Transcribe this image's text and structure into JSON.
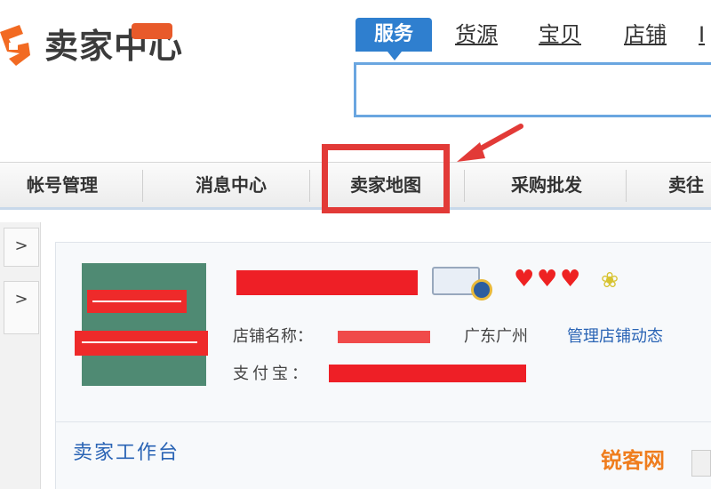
{
  "header": {
    "logo_text": "卖家中心",
    "search_tabs": [
      {
        "label": "服务",
        "active": true
      },
      {
        "label": "货源",
        "active": false
      },
      {
        "label": "宝贝",
        "active": false
      },
      {
        "label": "店铺",
        "active": false
      }
    ],
    "search_value": ""
  },
  "nav": {
    "items": [
      {
        "label": "帐号管理"
      },
      {
        "label": "消息中心"
      },
      {
        "label": "卖家地图",
        "highlighted": true
      },
      {
        "label": "采购批发"
      },
      {
        "label": "卖往"
      }
    ]
  },
  "sidebar": {
    "expand_1": ">",
    "expand_2": ">"
  },
  "shop": {
    "hearts": [
      "♥",
      "♥",
      "♥"
    ],
    "crown": "❀",
    "name_label": "店铺名称：",
    "location": "广东广州",
    "manage_link": "管理店铺动态",
    "alipay_label": "支付宝："
  },
  "workbench": {
    "title": "卖家工作台"
  },
  "watermark": {
    "text": "锐客网"
  },
  "colors": {
    "accent_blue": "#2f7fcf",
    "link_blue": "#2a64b5",
    "annotation_red": "#e23a37",
    "redaction_red": "#ee1f26",
    "avatar_green": "#4f8a73",
    "watermark_orange": "#ef7d1d"
  },
  "icons": {
    "logo": "taobao-logo-icon",
    "annotation": "red-arrow-icon",
    "certificate": "certificate-badge-icon",
    "crown": "crown-icon",
    "heart": "heart-icon"
  }
}
